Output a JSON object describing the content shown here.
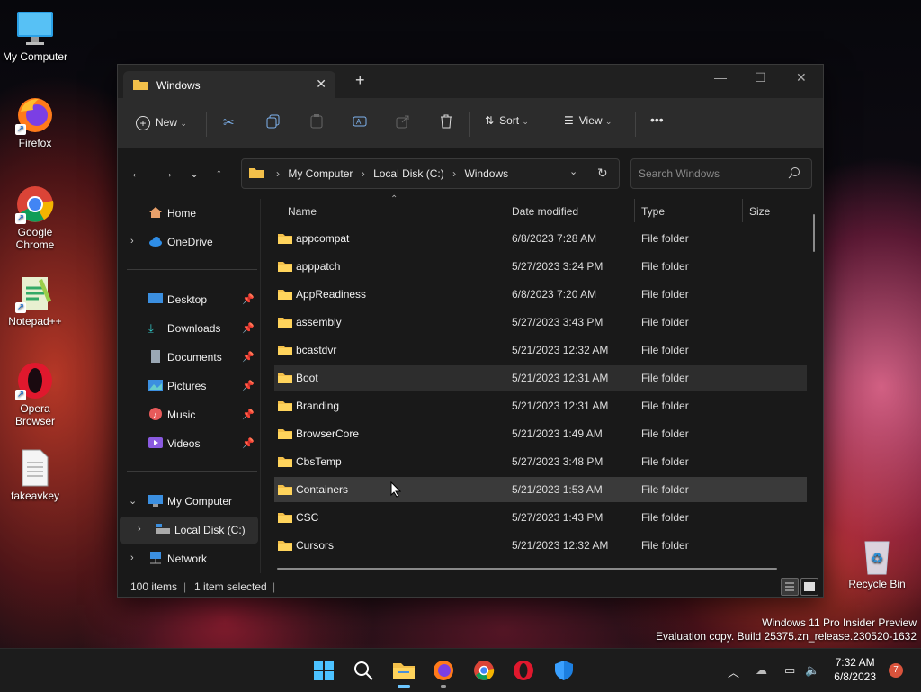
{
  "desktop": {
    "icons": [
      {
        "label": "My Computer"
      },
      {
        "label": "Firefox"
      },
      {
        "label": "Google Chrome"
      },
      {
        "label": "Notepad++"
      },
      {
        "label": "Opera Browser"
      },
      {
        "label": "fakeavkey"
      },
      {
        "label": "Recycle Bin"
      }
    ],
    "watermark_line1": "Windows 11 Pro Insider Preview",
    "watermark_line2": "Evaluation copy. Build 25375.zn_release.230520-1632"
  },
  "explorer": {
    "tab_title": "Windows",
    "toolbar": {
      "new_label": "New",
      "sort_label": "Sort",
      "view_label": "View",
      "more_label": "•••"
    },
    "breadcrumb": [
      "My Computer",
      "Local Disk (C:)",
      "Windows"
    ],
    "search_placeholder": "Search Windows",
    "nav": {
      "home": "Home",
      "onedrive": "OneDrive",
      "pinned": [
        "Desktop",
        "Downloads",
        "Documents",
        "Pictures",
        "Music",
        "Videos"
      ],
      "my_computer": "My Computer",
      "local_disk": "Local Disk (C:)",
      "network": "Network"
    },
    "columns": {
      "name": "Name",
      "date": "Date modified",
      "type": "Type",
      "size": "Size"
    },
    "files": [
      {
        "name": "appcompat",
        "date": "6/8/2023 7:28 AM",
        "type": "File folder"
      },
      {
        "name": "apppatch",
        "date": "5/27/2023 3:24 PM",
        "type": "File folder"
      },
      {
        "name": "AppReadiness",
        "date": "6/8/2023 7:20 AM",
        "type": "File folder"
      },
      {
        "name": "assembly",
        "date": "5/27/2023 3:43 PM",
        "type": "File folder"
      },
      {
        "name": "bcastdvr",
        "date": "5/21/2023 12:32 AM",
        "type": "File folder"
      },
      {
        "name": "Boot",
        "date": "5/21/2023 12:31 AM",
        "type": "File folder"
      },
      {
        "name": "Branding",
        "date": "5/21/2023 12:31 AM",
        "type": "File folder"
      },
      {
        "name": "BrowserCore",
        "date": "5/21/2023 1:49 AM",
        "type": "File folder"
      },
      {
        "name": "CbsTemp",
        "date": "5/27/2023 3:48 PM",
        "type": "File folder"
      },
      {
        "name": "Containers",
        "date": "5/21/2023 1:53 AM",
        "type": "File folder"
      },
      {
        "name": "CSC",
        "date": "5/27/2023 1:43 PM",
        "type": "File folder"
      },
      {
        "name": "Cursors",
        "date": "5/21/2023 12:32 AM",
        "type": "File folder"
      }
    ],
    "status": {
      "count": "100 items",
      "selected": "1 item selected"
    }
  },
  "taskbar": {
    "time": "7:32 AM",
    "date": "6/8/2023",
    "notification_count": "7"
  },
  "colors": {
    "accent": "#0078d4",
    "folder": "#f3c04a",
    "selection": "#3a3a3a"
  }
}
